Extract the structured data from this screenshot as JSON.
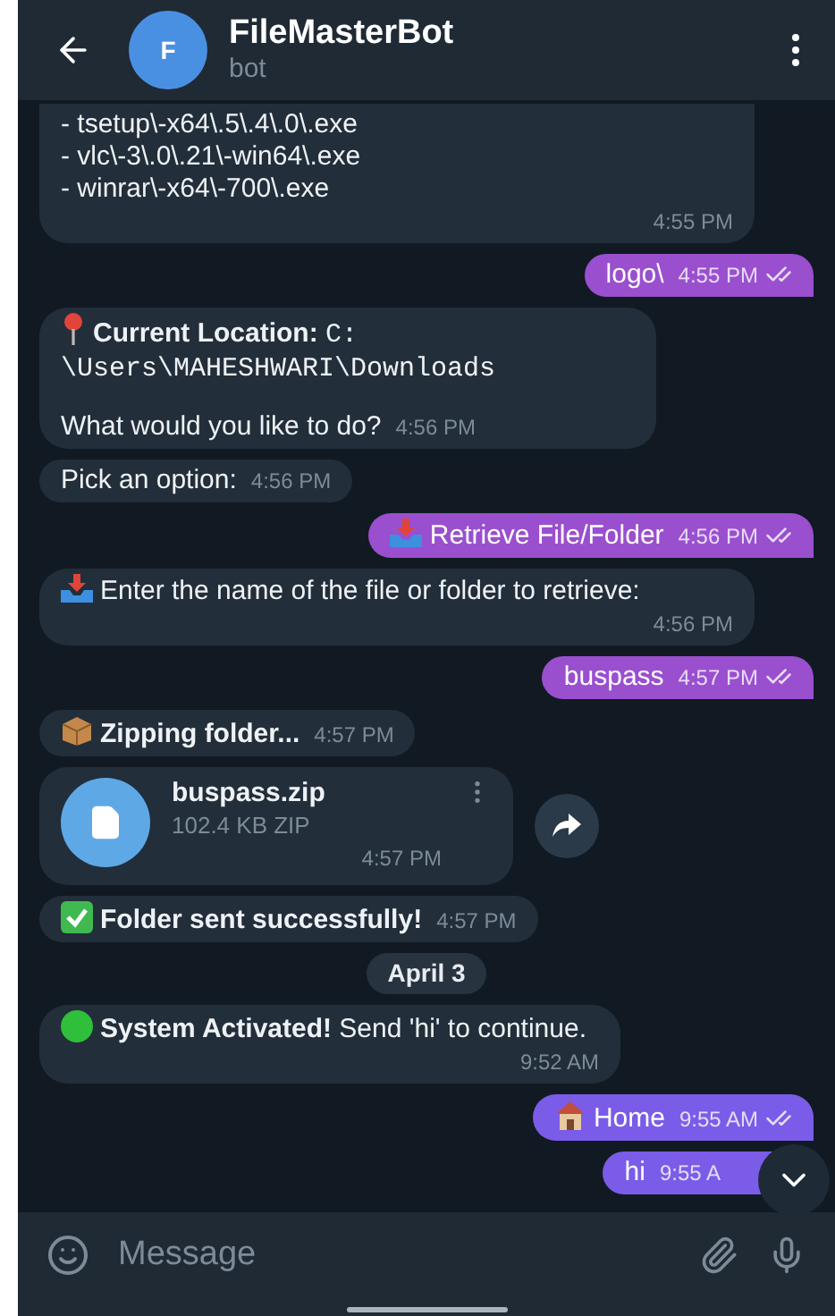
{
  "header": {
    "avatar_letter": "F",
    "title": "FileMasterBot",
    "subtitle": "bot"
  },
  "messages": [
    {
      "kind": "list",
      "lines": [
        "- tsetup\\-x64\\.5\\.4\\.0\\.exe",
        "- vlc\\-3\\.0\\.21\\-win64\\.exe",
        "- winrar\\-x64\\-700\\.exe"
      ],
      "time": "4:55 PM"
    },
    {
      "kind": "outgoing",
      "text": "logo\\",
      "time": "4:55 PM",
      "read": true,
      "color": "#9a4fcf"
    },
    {
      "kind": "location",
      "label": "Current Location:",
      "path": "C:\n\\Users\\MAHESHWARI\\Downloads",
      "text": "What would you like to do?",
      "time": "4:56 PM"
    },
    {
      "kind": "incoming",
      "text": "Pick an option:",
      "time": "4:56 PM"
    },
    {
      "kind": "outgoing",
      "text": "Retrieve File/Folder",
      "time": "4:56 PM",
      "read": true,
      "color": "#9a4fcf"
    },
    {
      "kind": "incoming",
      "text": "Enter the name of the file or folder to retrieve:",
      "time": "4:56 PM"
    },
    {
      "kind": "outgoing",
      "text": "buspass",
      "time": "4:57 PM",
      "read": true,
      "color": "#9a4fcf"
    },
    {
      "kind": "incoming",
      "text": "Zipping folder...",
      "time": "4:57 PM"
    },
    {
      "kind": "file",
      "name": "buspass.zip",
      "size": "102.4 KB ZIP",
      "time": "4:57 PM"
    },
    {
      "kind": "incoming",
      "text": "Folder sent successfully!",
      "time": "4:57 PM"
    },
    {
      "kind": "date",
      "text": "April 3"
    },
    {
      "kind": "incoming",
      "text": "**System Activated!** Send 'hi' to continue.",
      "time": "9:52 AM"
    },
    {
      "kind": "outgoing",
      "text": "Home",
      "time": "9:55 AM",
      "read": true,
      "color": "#7a5ce8"
    },
    {
      "kind": "outgoing",
      "text": "hi",
      "time": "9:55 A",
      "read": false,
      "color": "#7a5ce8"
    }
  ],
  "composer": {
    "placeholder": "Message"
  }
}
